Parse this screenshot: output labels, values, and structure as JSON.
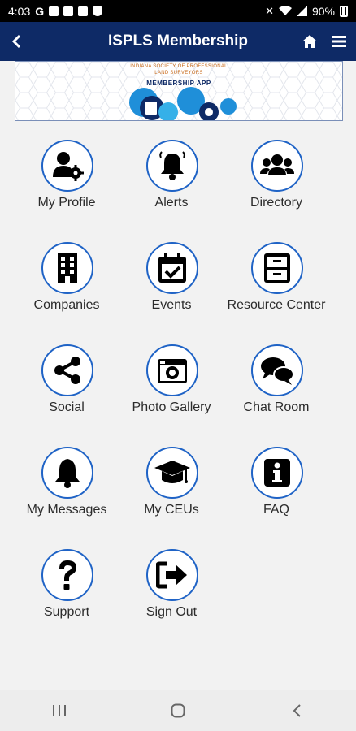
{
  "status_bar": {
    "time": "4:03",
    "battery": "90%"
  },
  "header": {
    "title": "ISPLS Membership"
  },
  "banner": {
    "org_line1": "INDIANA SOCIETY OF PROFESSIONAL",
    "org_line2": "LAND SURVEYORS",
    "app_label": "MEMBERSHIP APP"
  },
  "tiles": [
    {
      "label": "My Profile",
      "icon": "user-gear-icon"
    },
    {
      "label": "Alerts",
      "icon": "bell-icon"
    },
    {
      "label": "Directory",
      "icon": "users-icon"
    },
    {
      "label": "Companies",
      "icon": "building-icon"
    },
    {
      "label": "Events",
      "icon": "calendar-check-icon"
    },
    {
      "label": "Resource Center",
      "icon": "file-cabinet-icon"
    },
    {
      "label": "Social",
      "icon": "share-icon"
    },
    {
      "label": "Photo Gallery",
      "icon": "camera-icon"
    },
    {
      "label": "Chat Room",
      "icon": "chat-bubbles-icon"
    },
    {
      "label": "My Messages",
      "icon": "bell-icon"
    },
    {
      "label": "My CEUs",
      "icon": "graduation-cap-icon"
    },
    {
      "label": "FAQ",
      "icon": "info-icon"
    },
    {
      "label": "Support",
      "icon": "question-icon"
    },
    {
      "label": "Sign Out",
      "icon": "sign-out-icon"
    }
  ],
  "colors": {
    "header_bg": "#0e2a66",
    "circle_border": "#1f63c6",
    "page_bg": "#f2f2f2"
  }
}
